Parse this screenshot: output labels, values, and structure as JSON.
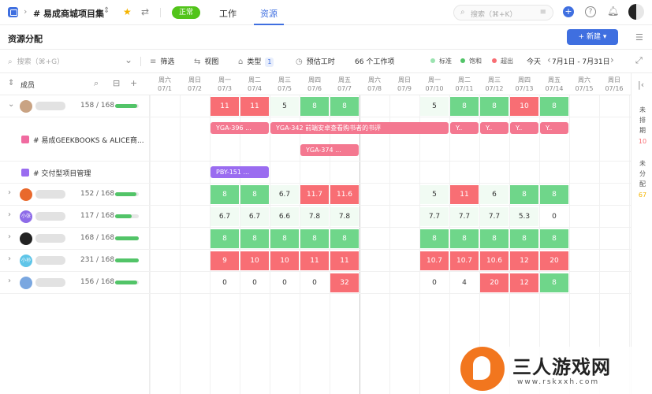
{
  "topbar": {
    "project_name": "# 易成商城项目集",
    "status": "正常",
    "tabs": [
      "工作",
      "资源"
    ],
    "search_placeholder": "搜索（⌘+K）"
  },
  "page": {
    "title": "资源分配",
    "new_button": "+ 新建 ▾"
  },
  "toolbar": {
    "search_placeholder": "搜索（⌘+G）",
    "filter": "筛选",
    "view": "视图",
    "type": "类型",
    "type_count": "1",
    "estimate": "预估工时",
    "work_items": "66 个工作项",
    "legend": [
      {
        "label": "标准",
        "color": "#9be3b0"
      },
      {
        "label": "饱和",
        "color": "#52c468"
      },
      {
        "label": "超出",
        "color": "#f86e74"
      }
    ],
    "today": "今天",
    "date_range": "7月1日 - 7月31日"
  },
  "member_header": {
    "label": "成员"
  },
  "days": [
    {
      "w": "周六",
      "d": "07/1"
    },
    {
      "w": "周日",
      "d": "07/2"
    },
    {
      "w": "周一",
      "d": "07/3"
    },
    {
      "w": "周二",
      "d": "07/4"
    },
    {
      "w": "周三",
      "d": "07/5"
    },
    {
      "w": "周四",
      "d": "07/6"
    },
    {
      "w": "周五",
      "d": "07/7"
    },
    {
      "w": "周六",
      "d": "07/8"
    },
    {
      "w": "周日",
      "d": "07/9"
    },
    {
      "w": "周一",
      "d": "07/10"
    },
    {
      "w": "周二",
      "d": "07/11"
    },
    {
      "w": "周三",
      "d": "07/12"
    },
    {
      "w": "周四",
      "d": "07/13"
    },
    {
      "w": "周五",
      "d": "07/14"
    },
    {
      "w": "周六",
      "d": "07/15"
    },
    {
      "w": "周日",
      "d": "07/16"
    }
  ],
  "members": [
    {
      "hours": "158 / 168",
      "load": 0.94,
      "avatar_color": "#c9a383",
      "avatar_text": ""
    },
    {
      "hours": "152 / 168",
      "load": 0.9,
      "avatar_color": "#e9692c",
      "avatar_text": ""
    },
    {
      "hours": "117 / 168",
      "load": 0.7,
      "avatar_color": "#8d6be8",
      "avatar_text": "小张"
    },
    {
      "hours": "168 / 168",
      "load": 1.0,
      "avatar_color": "#222222",
      "avatar_text": ""
    },
    {
      "hours": "231 / 168",
      "load": 1.0,
      "avatar_color": "#5fc5e8",
      "avatar_text": "小孙"
    },
    {
      "hours": "156 / 168",
      "load": 0.93,
      "avatar_color": "#7aa7e0",
      "avatar_text": ""
    }
  ],
  "projects": [
    {
      "label": "# 易成GEEKBOOKS & ALICE商...",
      "color": "#f06ba0"
    },
    {
      "label": "# 交付型项目管理",
      "color": "#9a6cf0"
    }
  ],
  "grid_rows": [
    [
      null,
      null,
      [
        "11",
        "red"
      ],
      [
        "11",
        "red"
      ],
      [
        "5",
        "light"
      ],
      [
        "8",
        "green"
      ],
      [
        "8",
        "green"
      ],
      null,
      null,
      [
        "5",
        "light"
      ],
      [
        "8",
        "green"
      ],
      [
        "8",
        "green"
      ],
      [
        "10",
        "red"
      ],
      [
        "8",
        "green"
      ],
      null,
      null
    ],
    [
      null,
      null,
      [
        "8",
        "green"
      ],
      [
        "8",
        "green"
      ],
      [
        "6.7",
        "light"
      ],
      [
        "11.7",
        "red"
      ],
      [
        "11.6",
        "red"
      ],
      null,
      null,
      [
        "5",
        "light"
      ],
      [
        "11",
        "red"
      ],
      [
        "6",
        "light"
      ],
      [
        "8",
        "green"
      ],
      [
        "8",
        "green"
      ],
      null,
      null
    ],
    [
      null,
      null,
      [
        "6.7",
        "light"
      ],
      [
        "6.7",
        "light"
      ],
      [
        "6.6",
        "light"
      ],
      [
        "7.8",
        "light"
      ],
      [
        "7.8",
        "light"
      ],
      null,
      null,
      [
        "7.7",
        "light"
      ],
      [
        "7.7",
        "light"
      ],
      [
        "7.7",
        "light"
      ],
      [
        "5.3",
        "light"
      ],
      [
        "0",
        "plain"
      ],
      null,
      null
    ],
    [
      null,
      null,
      [
        "8",
        "green"
      ],
      [
        "8",
        "green"
      ],
      [
        "8",
        "green"
      ],
      [
        "8",
        "green"
      ],
      [
        "8",
        "green"
      ],
      null,
      null,
      [
        "8",
        "green"
      ],
      [
        "8",
        "green"
      ],
      [
        "8",
        "green"
      ],
      [
        "8",
        "green"
      ],
      [
        "8",
        "green"
      ],
      null,
      null
    ],
    [
      null,
      null,
      [
        "9",
        "red"
      ],
      [
        "10",
        "red"
      ],
      [
        "10",
        "red"
      ],
      [
        "11",
        "red"
      ],
      [
        "11",
        "red"
      ],
      null,
      null,
      [
        "10.7",
        "red"
      ],
      [
        "10.7",
        "red"
      ],
      [
        "10.6",
        "red"
      ],
      [
        "12",
        "red"
      ],
      [
        "20",
        "red"
      ],
      null,
      null
    ],
    [
      null,
      null,
      [
        "0",
        "plain"
      ],
      [
        "0",
        "plain"
      ],
      [
        "0",
        "plain"
      ],
      [
        "0",
        "plain"
      ],
      [
        "32",
        "red"
      ],
      null,
      null,
      [
        "0",
        "plain"
      ],
      [
        "4",
        "plain"
      ],
      [
        "20",
        "red"
      ],
      [
        "12",
        "red"
      ],
      [
        "8",
        "green"
      ],
      null,
      null
    ]
  ],
  "tasks": [
    {
      "label": "YGA-396 ...",
      "start": 2,
      "span": 2,
      "color": "pink",
      "lane": 0
    },
    {
      "label": "YGA-342  前端安卓查看购书者的书评",
      "start": 4,
      "span": 6,
      "color": "pink",
      "lane": 0
    },
    {
      "label": "Y..",
      "start": 10,
      "span": 1,
      "color": "pink",
      "lane": 0
    },
    {
      "label": "Y..",
      "start": 11,
      "span": 1,
      "color": "pink",
      "lane": 0
    },
    {
      "label": "Y..",
      "start": 12,
      "span": 1,
      "color": "pink",
      "lane": 0
    },
    {
      "label": "Y..",
      "start": 13,
      "span": 1,
      "color": "pink",
      "lane": 0
    },
    {
      "label": "YGA-374 ...",
      "start": 5,
      "span": 2,
      "color": "pink",
      "lane": 1
    },
    {
      "label": "PBY-151  ...",
      "start": 2,
      "span": 2,
      "color": "purple",
      "lane": 2
    }
  ],
  "right_panel": {
    "unscheduled_label": "未排期",
    "unscheduled_count": "10",
    "unassigned_label": "未分配",
    "unassigned_count": "67"
  },
  "watermark": {
    "title": "三人游戏网",
    "url": "www.rskxxh.com"
  }
}
